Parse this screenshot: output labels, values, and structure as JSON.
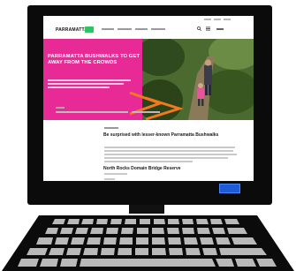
{
  "hero": {
    "title": "PARRAMATTA BUSHWALKS TO GET AWAY FROM THE CROWDS"
  },
  "site": {
    "logo_text": "PARRAMATTA"
  },
  "article": {
    "heading_1": "Be surprised with lesser-known Parramatta Bushwalks",
    "heading_2": "North Rocks Domain Bridge Reserve"
  },
  "icons": {
    "search": "search-icon",
    "menu": "menu-icon",
    "arrow": "orange-chevron-arrow-icon"
  },
  "colors": {
    "monitor": "#0b0b0b",
    "hero_pink": "#e82a96",
    "logo_accent": "#2fc462",
    "power_led": "#1e5bd6",
    "arrow": "#f07a1e"
  }
}
